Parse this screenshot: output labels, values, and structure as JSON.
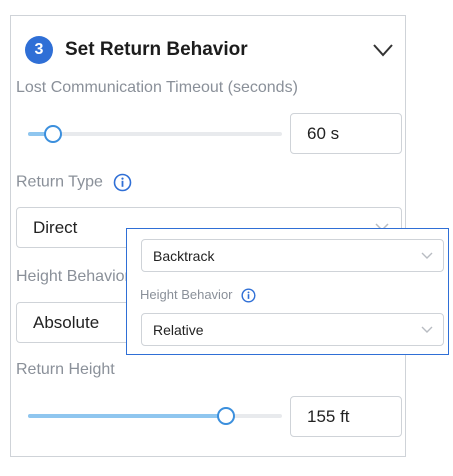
{
  "section": {
    "step_number": "3",
    "title": "Set Return Behavior"
  },
  "timeout": {
    "label": "Lost Communication Timeout (seconds)",
    "value_text": "60 s",
    "slider_fraction": 0.1
  },
  "return_type": {
    "label": "Return Type",
    "selected": "Direct"
  },
  "height_behavior": {
    "label": "Height Behavior",
    "selected": "Absolute"
  },
  "return_height": {
    "label": "Return Height",
    "value_text": "155 ft",
    "slider_fraction": 0.78
  },
  "popup": {
    "return_type_selected": "Backtrack",
    "height_behavior_label": "Height Behavior",
    "height_behavior_selected": "Relative"
  },
  "colors": {
    "accent": "#2f6fd6",
    "slider_fill": "#8fc6ef",
    "border": "#cfd3d8",
    "label": "#8a9099"
  },
  "icons": [
    "chevron-down-icon",
    "info-icon"
  ]
}
